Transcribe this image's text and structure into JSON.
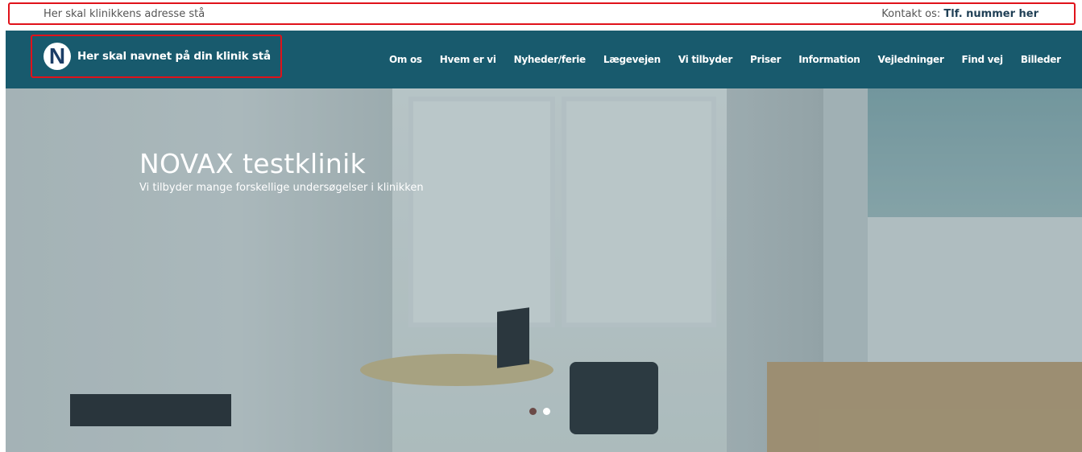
{
  "topbar": {
    "address": "Her skal klinikkens adresse stå",
    "contact_label": "Kontakt os:",
    "contact_phone": "Tlf. nummer her"
  },
  "nav": {
    "logo_letter": "N",
    "clinic_name": "Her skal navnet på din klinik stå",
    "items": [
      "Om os",
      "Hvem er vi",
      "Nyheder/ferie",
      "Lægevejen",
      "Vi tilbyder",
      "Priser",
      "Information",
      "Vejledninger",
      "Find vej",
      "Billeder"
    ]
  },
  "hero": {
    "title": "NOVAX testklinik",
    "subtitle": "Vi tilbyder mange forskellige undersøgelser i klinikken",
    "slide_dots": 2,
    "active_slide": 2
  },
  "colors": {
    "nav_bg": "#185a6d",
    "highlight_border": "#e0121a",
    "logo_text": "#1b3d66"
  }
}
